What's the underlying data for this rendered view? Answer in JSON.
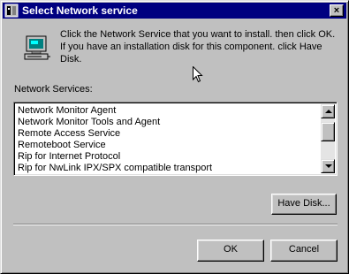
{
  "window": {
    "title": "Select Network service",
    "close_label": "×"
  },
  "dialog": {
    "instructions": "Click the Network Service that you want to install. then click OK. If you have an installation disk for this component. click Have Disk.",
    "list_label": "Network Services:"
  },
  "services": [
    "Network Monitor Agent",
    "Network Monitor Tools and Agent",
    "Remote Access Service",
    "Remoteboot Service",
    "Rip for Internet Protocol",
    "Rip for NwLink IPX/SPX compatible transport"
  ],
  "buttons": {
    "have_disk": "Have Disk...",
    "ok": "OK",
    "cancel": "Cancel"
  },
  "icons": {
    "title": "network-setup-icon",
    "dialog": "network-computer-icon",
    "cursor": "mouse-pointer-icon"
  },
  "colors": {
    "titlebar": "#000080",
    "face": "#c0c0c0"
  }
}
